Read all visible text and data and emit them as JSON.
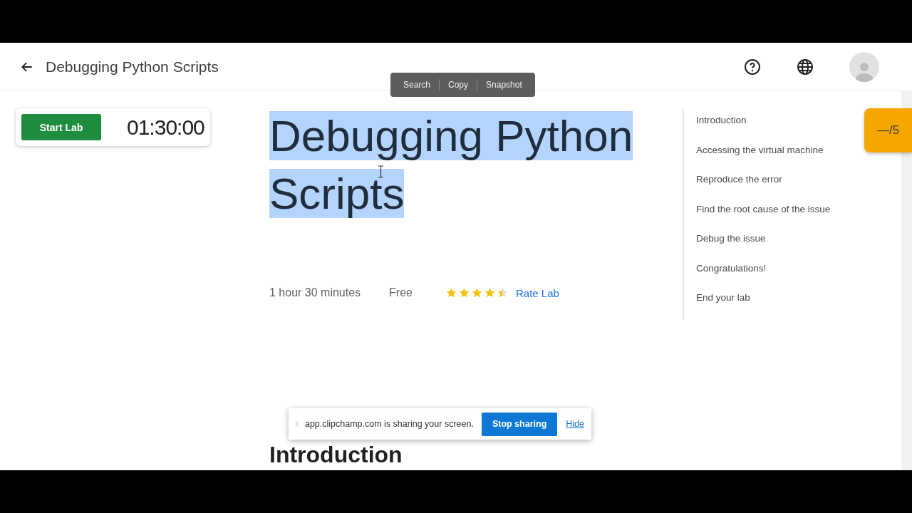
{
  "header": {
    "title": "Debugging Python Scripts"
  },
  "lab_panel": {
    "start_button": "Start Lab",
    "timer": "01:30:00"
  },
  "selection_popup": {
    "actions": [
      "Search",
      "Copy",
      "Snapshot"
    ]
  },
  "lab_title": {
    "text": "Debugging Python Scripts",
    "selected": true
  },
  "meta": {
    "duration": "1 hour 30 minutes",
    "price": "Free",
    "stars": 4.5,
    "rate_link": "Rate Lab"
  },
  "toc": [
    {
      "label": "Introduction"
    },
    {
      "label": "Accessing the virtual machine"
    },
    {
      "label": "Reproduce the error"
    },
    {
      "label": "Find the root cause of the issue"
    },
    {
      "label": "Debug the issue"
    },
    {
      "label": "Congratulations!"
    },
    {
      "label": "End your lab"
    }
  ],
  "progress_badge": {
    "text": "—/5"
  },
  "section_heading": "Introduction",
  "sharing_bar": {
    "message": "app.clipchamp.com is sharing your screen.",
    "stop_button": "Stop sharing",
    "hide_link": "Hide"
  }
}
